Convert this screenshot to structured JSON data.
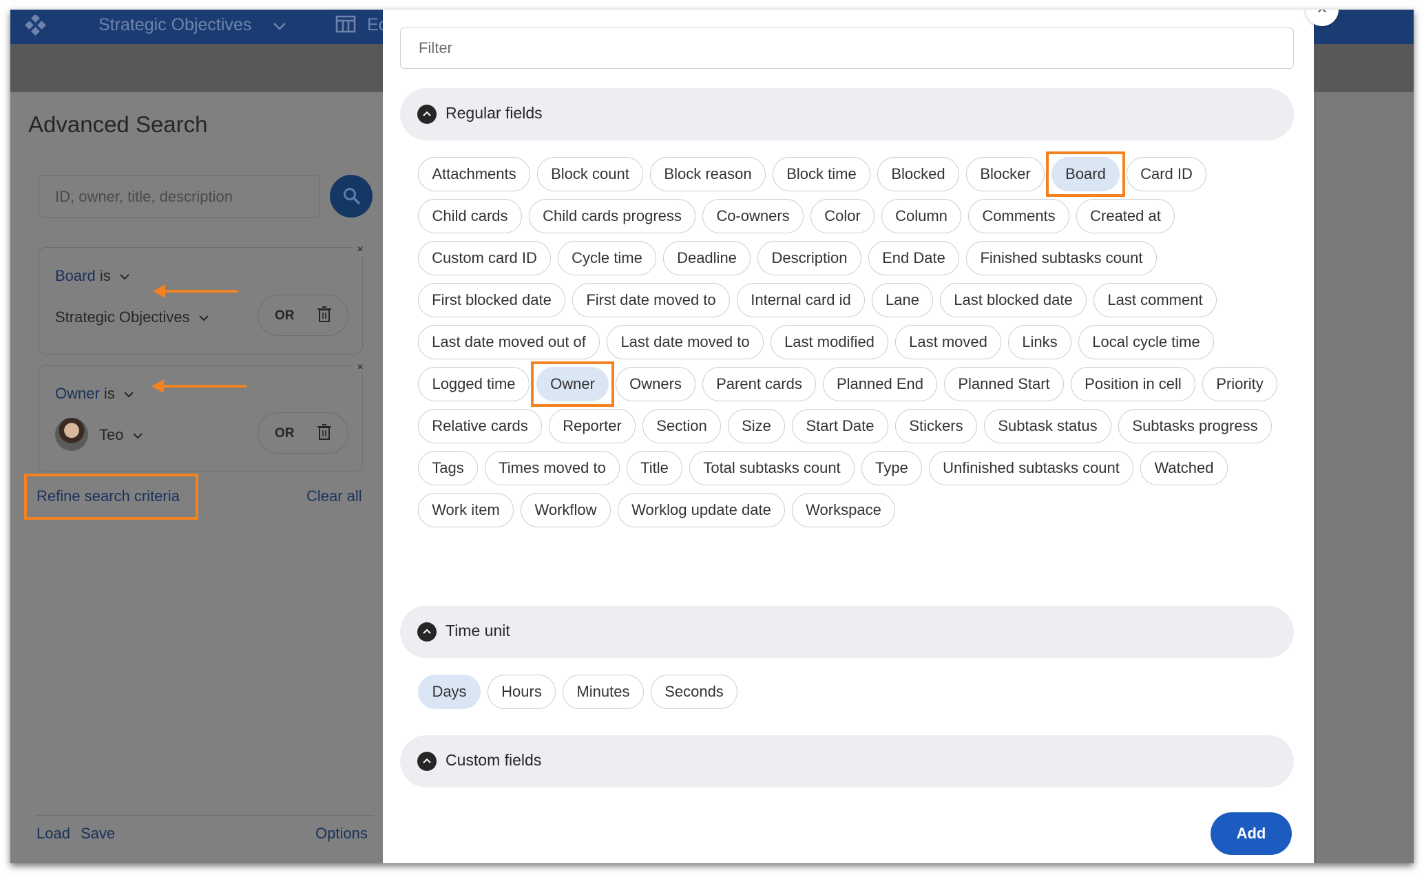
{
  "topbar": {
    "board_title": "Strategic Objectives",
    "cut_text": "Ec"
  },
  "advanced_search": {
    "title": "Advanced Search",
    "search_placeholder": "ID, owner, title, description",
    "filters": [
      {
        "field": "Board",
        "operator": "is",
        "value": "Strategic Objectives",
        "or_label": "OR"
      },
      {
        "field": "Owner",
        "operator": "is",
        "value": "Teo",
        "or_label": "OR"
      }
    ],
    "refine_label": "Refine search criteria",
    "clear_all_label": "Clear all",
    "footer": {
      "load": "Load",
      "save": "Save",
      "options": "Options"
    }
  },
  "modal": {
    "close_glyph": "×",
    "filter_placeholder": "Filter",
    "sections": {
      "regular": {
        "title": "Regular fields",
        "fields": [
          "Attachments",
          "Block count",
          "Block reason",
          "Block time",
          "Blocked",
          "Blocker",
          "Board",
          "Card ID",
          "Child cards",
          "Child cards progress",
          "Co-owners",
          "Color",
          "Column",
          "Comments",
          "Created at",
          "Custom card ID",
          "Cycle time",
          "Deadline",
          "Description",
          "End Date",
          "Finished subtasks count",
          "First blocked date",
          "First date moved to",
          "Internal card id",
          "Lane",
          "Last blocked date",
          "Last comment",
          "Last date moved out of",
          "Last date moved to",
          "Last modified",
          "Last moved",
          "Links",
          "Local cycle time",
          "Logged time",
          "Owner",
          "Owners",
          "Parent cards",
          "Planned End",
          "Planned Start",
          "Position in cell",
          "Priority",
          "Relative cards",
          "Reporter",
          "Section",
          "Size",
          "Start Date",
          "Stickers",
          "Subtask status",
          "Subtasks progress",
          "Tags",
          "Times moved to",
          "Title",
          "Total subtasks count",
          "Type",
          "Unfinished subtasks count",
          "Watched",
          "Work item",
          "Workflow",
          "Worklog update date",
          "Workspace"
        ],
        "selected": [
          "Board",
          "Owner"
        ]
      },
      "time_unit": {
        "title": "Time unit",
        "units": [
          "Days",
          "Hours",
          "Minutes",
          "Seconds"
        ],
        "selected": "Days"
      },
      "custom": {
        "title": "Custom fields"
      }
    },
    "add_label": "Add"
  },
  "colors": {
    "accent_orange": "#f48221",
    "primary_blue": "#1c5bbf",
    "selected_chip": "#dbe6f5",
    "navy": "#1a3c73"
  },
  "icons": [
    "logo-icon",
    "chevron-down-icon",
    "board-icon",
    "search-icon",
    "close-icon",
    "trash-icon",
    "collapse-icon",
    "arrow-left-icon"
  ]
}
